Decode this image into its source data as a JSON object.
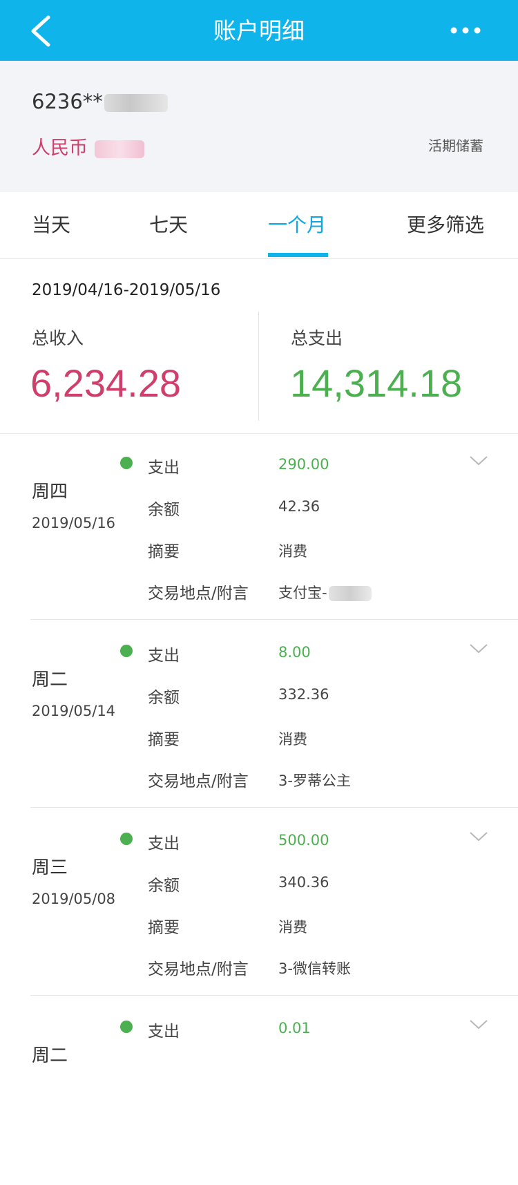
{
  "header": {
    "title": "账户明细",
    "back_icon": "chevron-left-icon",
    "more_icon": "more-horizontal-icon"
  },
  "account": {
    "number": "6236**",
    "currency": "人民币",
    "type": "活期储蓄"
  },
  "tabs": [
    {
      "label": "当天",
      "active": false
    },
    {
      "label": "七天",
      "active": false
    },
    {
      "label": "一个月",
      "active": true
    },
    {
      "label": "更多筛选",
      "active": false
    }
  ],
  "summary": {
    "date_range": "2019/04/16-2019/05/16",
    "income_label": "总收入",
    "income_value": "6,234.28",
    "expense_label": "总支出",
    "expense_value": "14,314.18"
  },
  "field_labels": {
    "type": "支出",
    "balance": "余额",
    "memo": "摘要",
    "location": "交易地点/附言"
  },
  "transactions": [
    {
      "weekday": "周四",
      "date": "2019/05/16",
      "amount": "290.00",
      "balance": "42.36",
      "memo": "消费",
      "location": "支付宝-"
    },
    {
      "weekday": "周二",
      "date": "2019/05/14",
      "amount": "8.00",
      "balance": "332.36",
      "memo": "消费",
      "location": "3-罗蒂公主"
    },
    {
      "weekday": "周三",
      "date": "2019/05/08",
      "amount": "500.00",
      "balance": "340.36",
      "memo": "消费",
      "location": "3-微信转账"
    },
    {
      "weekday": "周二",
      "date": "",
      "amount": "0.01",
      "balance": "",
      "memo": "",
      "location": ""
    }
  ],
  "colors": {
    "header_bg": "#0fb4ea",
    "income": "#cf3f6b",
    "expense": "#4caf50",
    "active_tab": "#0fa6e3"
  }
}
